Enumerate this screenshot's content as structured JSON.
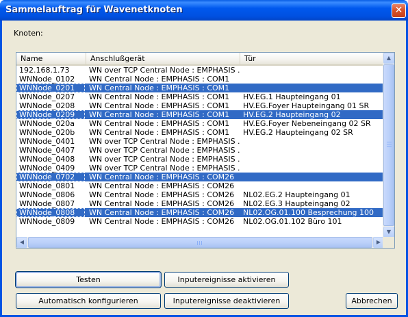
{
  "window": {
    "title": "Sammelauftrag für Wavenetknoten",
    "close_glyph": "✕"
  },
  "labels": {
    "knoten": "Knoten:"
  },
  "table": {
    "columns": [
      "Name",
      "Anschlußgerät",
      "Tür"
    ],
    "rows": [
      {
        "name": "192.168.1.73",
        "device": "WN over TCP Central Node : EMPHASIS ...",
        "door": "",
        "selected": false
      },
      {
        "name": "WNNode_0102",
        "device": "WN Central Node : EMPHASIS : COM1",
        "door": "",
        "selected": false
      },
      {
        "name": "WNNode_0201",
        "device": "WN Central Node : EMPHASIS : COM1",
        "door": "",
        "selected": true
      },
      {
        "name": "WNNode_0207",
        "device": "WN Central Node : EMPHASIS : COM1",
        "door": "HV.EG.1 Haupteingang 01",
        "selected": false
      },
      {
        "name": "WNNode_0208",
        "device": "WN Central Node : EMPHASIS : COM1",
        "door": "HV.EG.Foyer Haupteingang 01 SR",
        "selected": false
      },
      {
        "name": "WNNode_0209",
        "device": "WN Central Node : EMPHASIS : COM1",
        "door": "HV.EG.2 Haupteingang 02",
        "selected": true
      },
      {
        "name": "WNNode_020a",
        "device": "WN Central Node : EMPHASIS : COM1",
        "door": "HV.EG.Foyer Nebeneingang 02 SR",
        "selected": false
      },
      {
        "name": "WNNode_020b",
        "device": "WN Central Node : EMPHASIS : COM1",
        "door": "HV.EG.2 Haupteingang 02 SR",
        "selected": false
      },
      {
        "name": "WNNode_0401",
        "device": "WN over TCP Central Node : EMPHASIS ...",
        "door": "",
        "selected": false
      },
      {
        "name": "WNNode_0407",
        "device": "WN over TCP Central Node : EMPHASIS ...",
        "door": "",
        "selected": false
      },
      {
        "name": "WNNode_0408",
        "device": "WN over TCP Central Node : EMPHASIS ...",
        "door": "",
        "selected": false
      },
      {
        "name": "WNNode_0409",
        "device": "WN over TCP Central Node : EMPHASIS ...",
        "door": "",
        "selected": false
      },
      {
        "name": "WNNode_0702",
        "device": "WN Central Node : EMPHASIS : COM26",
        "door": "",
        "selected": true
      },
      {
        "name": "WNNode_0801",
        "device": "WN Central Node : EMPHASIS : COM26",
        "door": "",
        "selected": false
      },
      {
        "name": "WNNode_0806",
        "device": "WN Central Node : EMPHASIS : COM26",
        "door": "NL02.EG.2 Haupteingang 01",
        "selected": false
      },
      {
        "name": "WNNode_0807",
        "device": "WN Central Node : EMPHASIS : COM26",
        "door": "NL02.EG.3 Haupteingang 02",
        "selected": false
      },
      {
        "name": "WNNode_0808",
        "device": "WN Central Node : EMPHASIS : COM26",
        "door": "NL02.OG.01.100 Besprechung 100",
        "selected": true
      },
      {
        "name": "WNNode_0809",
        "device": "WN Central Node : EMPHASIS : COM26",
        "door": "NL02.OG.01.102 Büro 101",
        "selected": false
      }
    ]
  },
  "scroll": {
    "up": "▲",
    "down": "▼",
    "left": "◀",
    "right": "▶"
  },
  "buttons": {
    "testen": "Testen",
    "aktivieren": "Inputereignisse aktivieren",
    "auto": "Automatisch konfigurieren",
    "deaktivieren": "Inputereignisse deaktivieren",
    "abbrechen": "Abbrechen"
  },
  "colors": {
    "titlebar": "#0054e3",
    "selection": "#316ac5",
    "dialog_bg": "#ece9d8"
  }
}
